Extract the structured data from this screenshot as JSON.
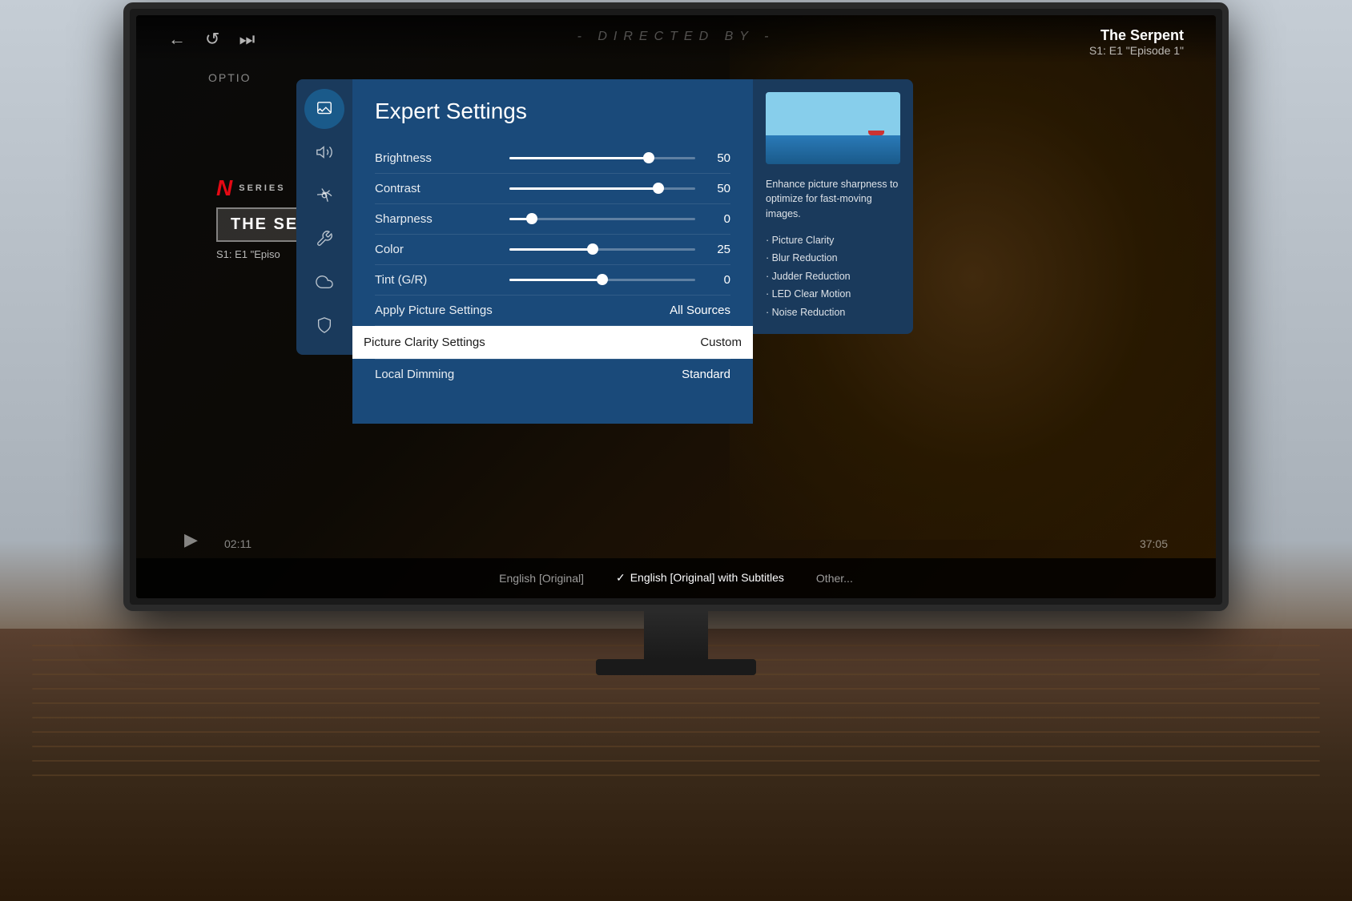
{
  "room": {
    "background_color": "#b0b8c1"
  },
  "tv": {
    "show_title": "The Serpent",
    "show_episode": "S1: E1 \"Episode 1\"",
    "directed_by": "- DIRECTED BY -",
    "options_label": "OPTIO",
    "time_current": "02:11",
    "time_remaining": "37:05",
    "play_icon": "▶"
  },
  "netflix": {
    "n_logo": "N",
    "series_label": "SERIES",
    "show_name": "THE SE",
    "episode_info": "S1: E1 \"Episo"
  },
  "audio_bar": {
    "option1": "English [Original]",
    "option2": "English [Original] with Subtitles",
    "option3": "Other...",
    "checkmark": "✓",
    "selected_index": 1
  },
  "sidebar": {
    "icons": [
      {
        "name": "picture-icon",
        "symbol": "🖼",
        "active": true
      },
      {
        "name": "sound-icon",
        "symbol": "🔊",
        "active": false
      },
      {
        "name": "broadcast-icon",
        "symbol": "📡",
        "active": false
      },
      {
        "name": "tools-icon",
        "symbol": "🔧",
        "active": false
      },
      {
        "name": "cloud-icon",
        "symbol": "☁",
        "active": false
      },
      {
        "name": "shield-icon",
        "symbol": "🛡",
        "active": false
      }
    ]
  },
  "expert_settings": {
    "title": "Expert Settings",
    "settings": [
      {
        "label": "Brightness",
        "value": 50,
        "value_display": "50",
        "percent": 75
      },
      {
        "label": "Contrast",
        "value": 50,
        "value_display": "50",
        "percent": 80
      },
      {
        "label": "Sharpness",
        "value": 0,
        "value_display": "0",
        "percent": 12
      },
      {
        "label": "Color",
        "value": 25,
        "value_display": "25",
        "percent": 45
      },
      {
        "label": "Tint (G/R)",
        "value": 0,
        "value_display": "0",
        "percent": 50
      }
    ],
    "apply_label": "Apply Picture Settings",
    "apply_value": "All Sources",
    "picture_clarity_label": "Picture Clarity Settings",
    "picture_clarity_value": "Custom",
    "local_dimming_label": "Local Dimming",
    "local_dimming_value": "Standard"
  },
  "info_panel": {
    "description": "Enhance picture sharpness to optimize for fast-moving images.",
    "features": [
      "· Picture Clarity",
      "· Blur Reduction",
      "· Judder Reduction",
      "· LED Clear Motion",
      "· Noise Reduction"
    ]
  }
}
